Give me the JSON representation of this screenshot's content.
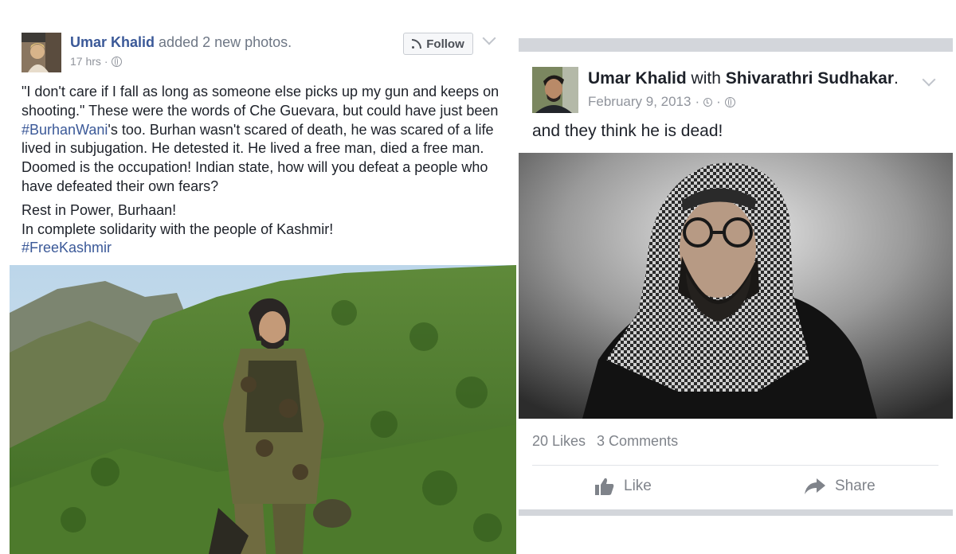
{
  "left_post": {
    "author": "Umar Khalid",
    "action": "added 2 new photos.",
    "time": "17 hrs",
    "dot": "·",
    "follow_label": "Follow",
    "body": {
      "quote": "\"I don't care if I fall as long as someone else picks up my gun and keeps on shooting.\" These were the words of Che Guevara, but could have just been ",
      "hashtag1": "#BurhanWani",
      "rest": "'s too. Burhan wasn't scared of death, he was scared of a life lived in subjugation. He detested it. He lived a free man, died a free man. Doomed is the occupation! Indian state, how will you defeat a people who have defeated their own fears?",
      "line2": "Rest in Power, Burhaan!",
      "line3": "In complete solidarity with the people of Kashmir!",
      "hashtag2": "#FreeKashmir"
    }
  },
  "right_post": {
    "author": "Umar Khalid",
    "with_word": "with",
    "tagged": "Shivarathri Sudhakar",
    "period": ".",
    "date": "February 9, 2013",
    "dot": "·",
    "text": "and they think he is dead!",
    "likes": "20 Likes",
    "comments": "3 Comments",
    "like_label": "Like",
    "share_label": "Share"
  },
  "colors": {
    "link_blue": "#3b5998",
    "text": "#1d2129",
    "meta_gray": "#90949c",
    "divider": "#d3d6db"
  }
}
